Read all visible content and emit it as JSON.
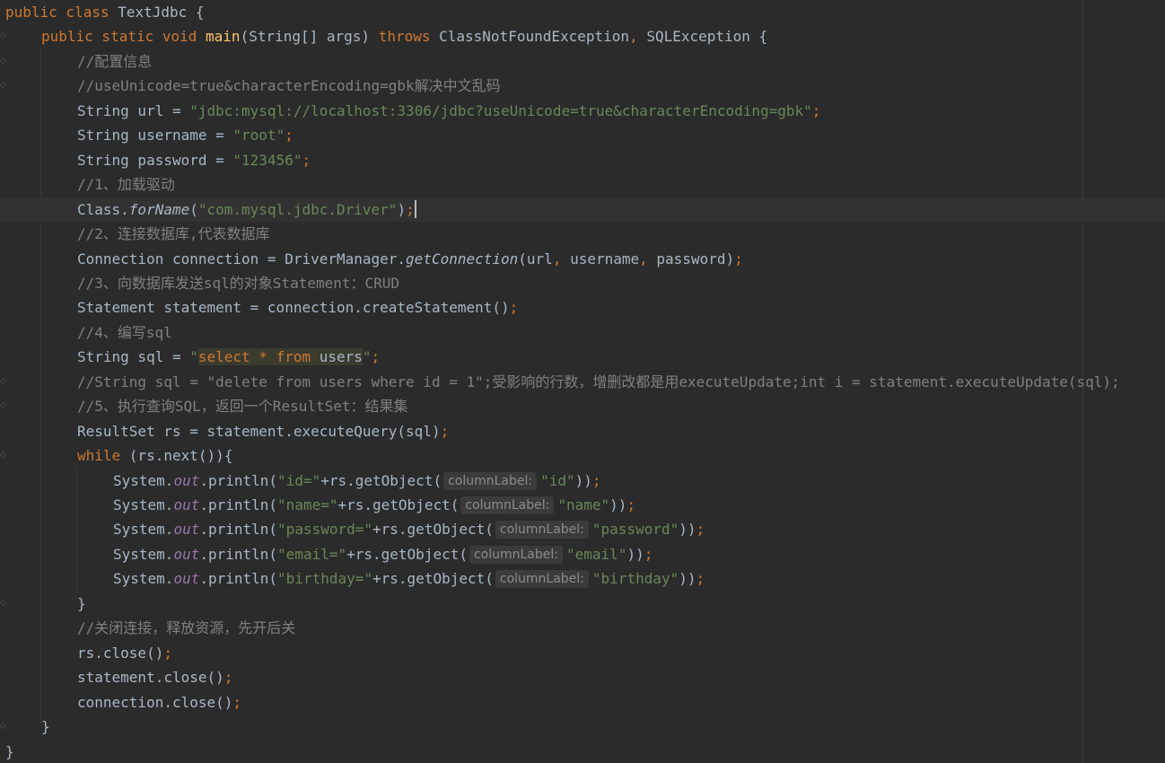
{
  "editor": {
    "language": "java",
    "theme": "darcula",
    "lines": [
      {
        "indent": 0,
        "tokens": [
          [
            "kw",
            "public class "
          ],
          [
            "p",
            "TextJdbc {"
          ]
        ]
      },
      {
        "indent": 1,
        "fold": true,
        "tokens": [
          [
            "kw",
            "public static void "
          ],
          [
            "fn",
            "main"
          ],
          [
            "p",
            "(String[] args) "
          ],
          [
            "kw",
            "throws "
          ],
          [
            "p",
            "ClassNotFoundException"
          ],
          [
            "kw",
            ", "
          ],
          [
            "p",
            "SQLException {"
          ]
        ]
      },
      {
        "indent": 2,
        "fold": true,
        "tokens": [
          [
            "cmt",
            "//配置信息"
          ]
        ]
      },
      {
        "indent": 2,
        "fold": true,
        "tokens": [
          [
            "cmt",
            "//useUnicode=true&characterEncoding=gbk解决中文乱码"
          ]
        ]
      },
      {
        "indent": 2,
        "tokens": [
          [
            "p",
            "String url = "
          ],
          [
            "str",
            "\"jdbc:mysql://localhost:3306/jdbc?useUnicode=true&characterEncoding=gbk\""
          ],
          [
            "kw",
            ";"
          ]
        ]
      },
      {
        "indent": 2,
        "tokens": [
          [
            "p",
            "String username = "
          ],
          [
            "str",
            "\"root\""
          ],
          [
            "kw",
            ";"
          ]
        ]
      },
      {
        "indent": 2,
        "tokens": [
          [
            "p",
            "String password = "
          ],
          [
            "str",
            "\"123456\""
          ],
          [
            "kw",
            ";"
          ]
        ]
      },
      {
        "indent": 2,
        "tokens": [
          [
            "cmt",
            "//1、加载驱动"
          ]
        ]
      },
      {
        "indent": 2,
        "current": true,
        "tokens": [
          [
            "p",
            "Class."
          ],
          [
            "ital",
            "forName"
          ],
          [
            "p",
            "("
          ],
          [
            "str",
            "\"com.mysql.jdbc.Driver\""
          ],
          [
            "p",
            ")"
          ],
          [
            "kw",
            ";"
          ],
          [
            "caret",
            ""
          ]
        ]
      },
      {
        "indent": 2,
        "tokens": [
          [
            "cmt",
            "//2、连接数据库,代表数据库"
          ]
        ]
      },
      {
        "indent": 2,
        "tokens": [
          [
            "p",
            "Connection connection = DriverManager."
          ],
          [
            "ital",
            "getConnection"
          ],
          [
            "p",
            "(url"
          ],
          [
            "kw",
            ", "
          ],
          [
            "p",
            "username"
          ],
          [
            "kw",
            ", "
          ],
          [
            "p",
            "password)"
          ],
          [
            "kw",
            ";"
          ]
        ]
      },
      {
        "indent": 2,
        "tokens": [
          [
            "cmt",
            "//3、向数据库发送sql的对象Statement：CRUD"
          ]
        ]
      },
      {
        "indent": 2,
        "tokens": [
          [
            "p",
            "Statement statement = connection.createStatement()"
          ],
          [
            "kw",
            ";"
          ]
        ]
      },
      {
        "indent": 2,
        "tokens": [
          [
            "cmt",
            "//4、编写sql"
          ]
        ]
      },
      {
        "indent": 2,
        "tokens": [
          [
            "p",
            "String sql = "
          ],
          [
            "str",
            "\""
          ],
          [
            "sqlkw",
            "select * from "
          ],
          [
            "sqlid",
            "users"
          ],
          [
            "str",
            "\""
          ],
          [
            "kw",
            ";"
          ]
        ]
      },
      {
        "indent": 2,
        "fold": true,
        "tokens": [
          [
            "cmt",
            "//String sql = \"delete from users where id = 1\";受影响的行数，增删改都是用executeUpdate;int i = statement.executeUpdate(sql);"
          ]
        ]
      },
      {
        "indent": 2,
        "fold": true,
        "tokens": [
          [
            "cmt",
            "//5、执行查询SQL，返回一个ResultSet：结果集"
          ]
        ]
      },
      {
        "indent": 2,
        "tokens": [
          [
            "p",
            "ResultSet rs = statement.executeQuery(sql)"
          ],
          [
            "kw",
            ";"
          ]
        ]
      },
      {
        "indent": 2,
        "fold": true,
        "tokens": [
          [
            "kw",
            "while "
          ],
          [
            "p",
            "(rs.next()){"
          ]
        ]
      },
      {
        "indent": 3,
        "tokens": [
          [
            "p",
            "System."
          ],
          [
            "field",
            "out"
          ],
          [
            "p",
            ".println("
          ],
          [
            "str",
            "\"id=\""
          ],
          [
            "p",
            "+rs.getObject("
          ],
          [
            "hint",
            "columnLabel:"
          ],
          [
            "str",
            "\"id\""
          ],
          [
            "p",
            "))"
          ],
          [
            "kw",
            ";"
          ]
        ]
      },
      {
        "indent": 3,
        "tokens": [
          [
            "p",
            "System."
          ],
          [
            "field",
            "out"
          ],
          [
            "p",
            ".println("
          ],
          [
            "str",
            "\"name=\""
          ],
          [
            "p",
            "+rs.getObject("
          ],
          [
            "hint",
            "columnLabel:"
          ],
          [
            "str",
            "\"name\""
          ],
          [
            "p",
            "))"
          ],
          [
            "kw",
            ";"
          ]
        ]
      },
      {
        "indent": 3,
        "tokens": [
          [
            "p",
            "System."
          ],
          [
            "field",
            "out"
          ],
          [
            "p",
            ".println("
          ],
          [
            "str",
            "\"password=\""
          ],
          [
            "p",
            "+rs.getObject("
          ],
          [
            "hint",
            "columnLabel:"
          ],
          [
            "str",
            "\"password\""
          ],
          [
            "p",
            "))"
          ],
          [
            "kw",
            ";"
          ]
        ]
      },
      {
        "indent": 3,
        "tokens": [
          [
            "p",
            "System."
          ],
          [
            "field",
            "out"
          ],
          [
            "p",
            ".println("
          ],
          [
            "str",
            "\"email=\""
          ],
          [
            "p",
            "+rs.getObject("
          ],
          [
            "hint",
            "columnLabel:"
          ],
          [
            "str",
            "\"email\""
          ],
          [
            "p",
            "))"
          ],
          [
            "kw",
            ";"
          ]
        ]
      },
      {
        "indent": 3,
        "tokens": [
          [
            "p",
            "System."
          ],
          [
            "field",
            "out"
          ],
          [
            "p",
            ".println("
          ],
          [
            "str",
            "\"birthday=\""
          ],
          [
            "p",
            "+rs.getObject("
          ],
          [
            "hint",
            "columnLabel:"
          ],
          [
            "str",
            "\"birthday\""
          ],
          [
            "p",
            "))"
          ],
          [
            "kw",
            ";"
          ]
        ]
      },
      {
        "indent": 2,
        "fold": true,
        "tokens": [
          [
            "p",
            "}"
          ]
        ]
      },
      {
        "indent": 2,
        "tokens": [
          [
            "cmt",
            "//关闭连接，释放资源，先开后关"
          ]
        ]
      },
      {
        "indent": 2,
        "tokens": [
          [
            "p",
            "rs.close()"
          ],
          [
            "kw",
            ";"
          ]
        ]
      },
      {
        "indent": 2,
        "tokens": [
          [
            "p",
            "statement.close()"
          ],
          [
            "kw",
            ";"
          ]
        ]
      },
      {
        "indent": 2,
        "tokens": [
          [
            "p",
            "connection.close()"
          ],
          [
            "kw",
            ";"
          ]
        ]
      },
      {
        "indent": 1,
        "fold": true,
        "tokens": [
          [
            "p",
            "}"
          ]
        ]
      },
      {
        "indent": 0,
        "tokens": [
          [
            "p",
            "}"
          ]
        ]
      }
    ]
  }
}
